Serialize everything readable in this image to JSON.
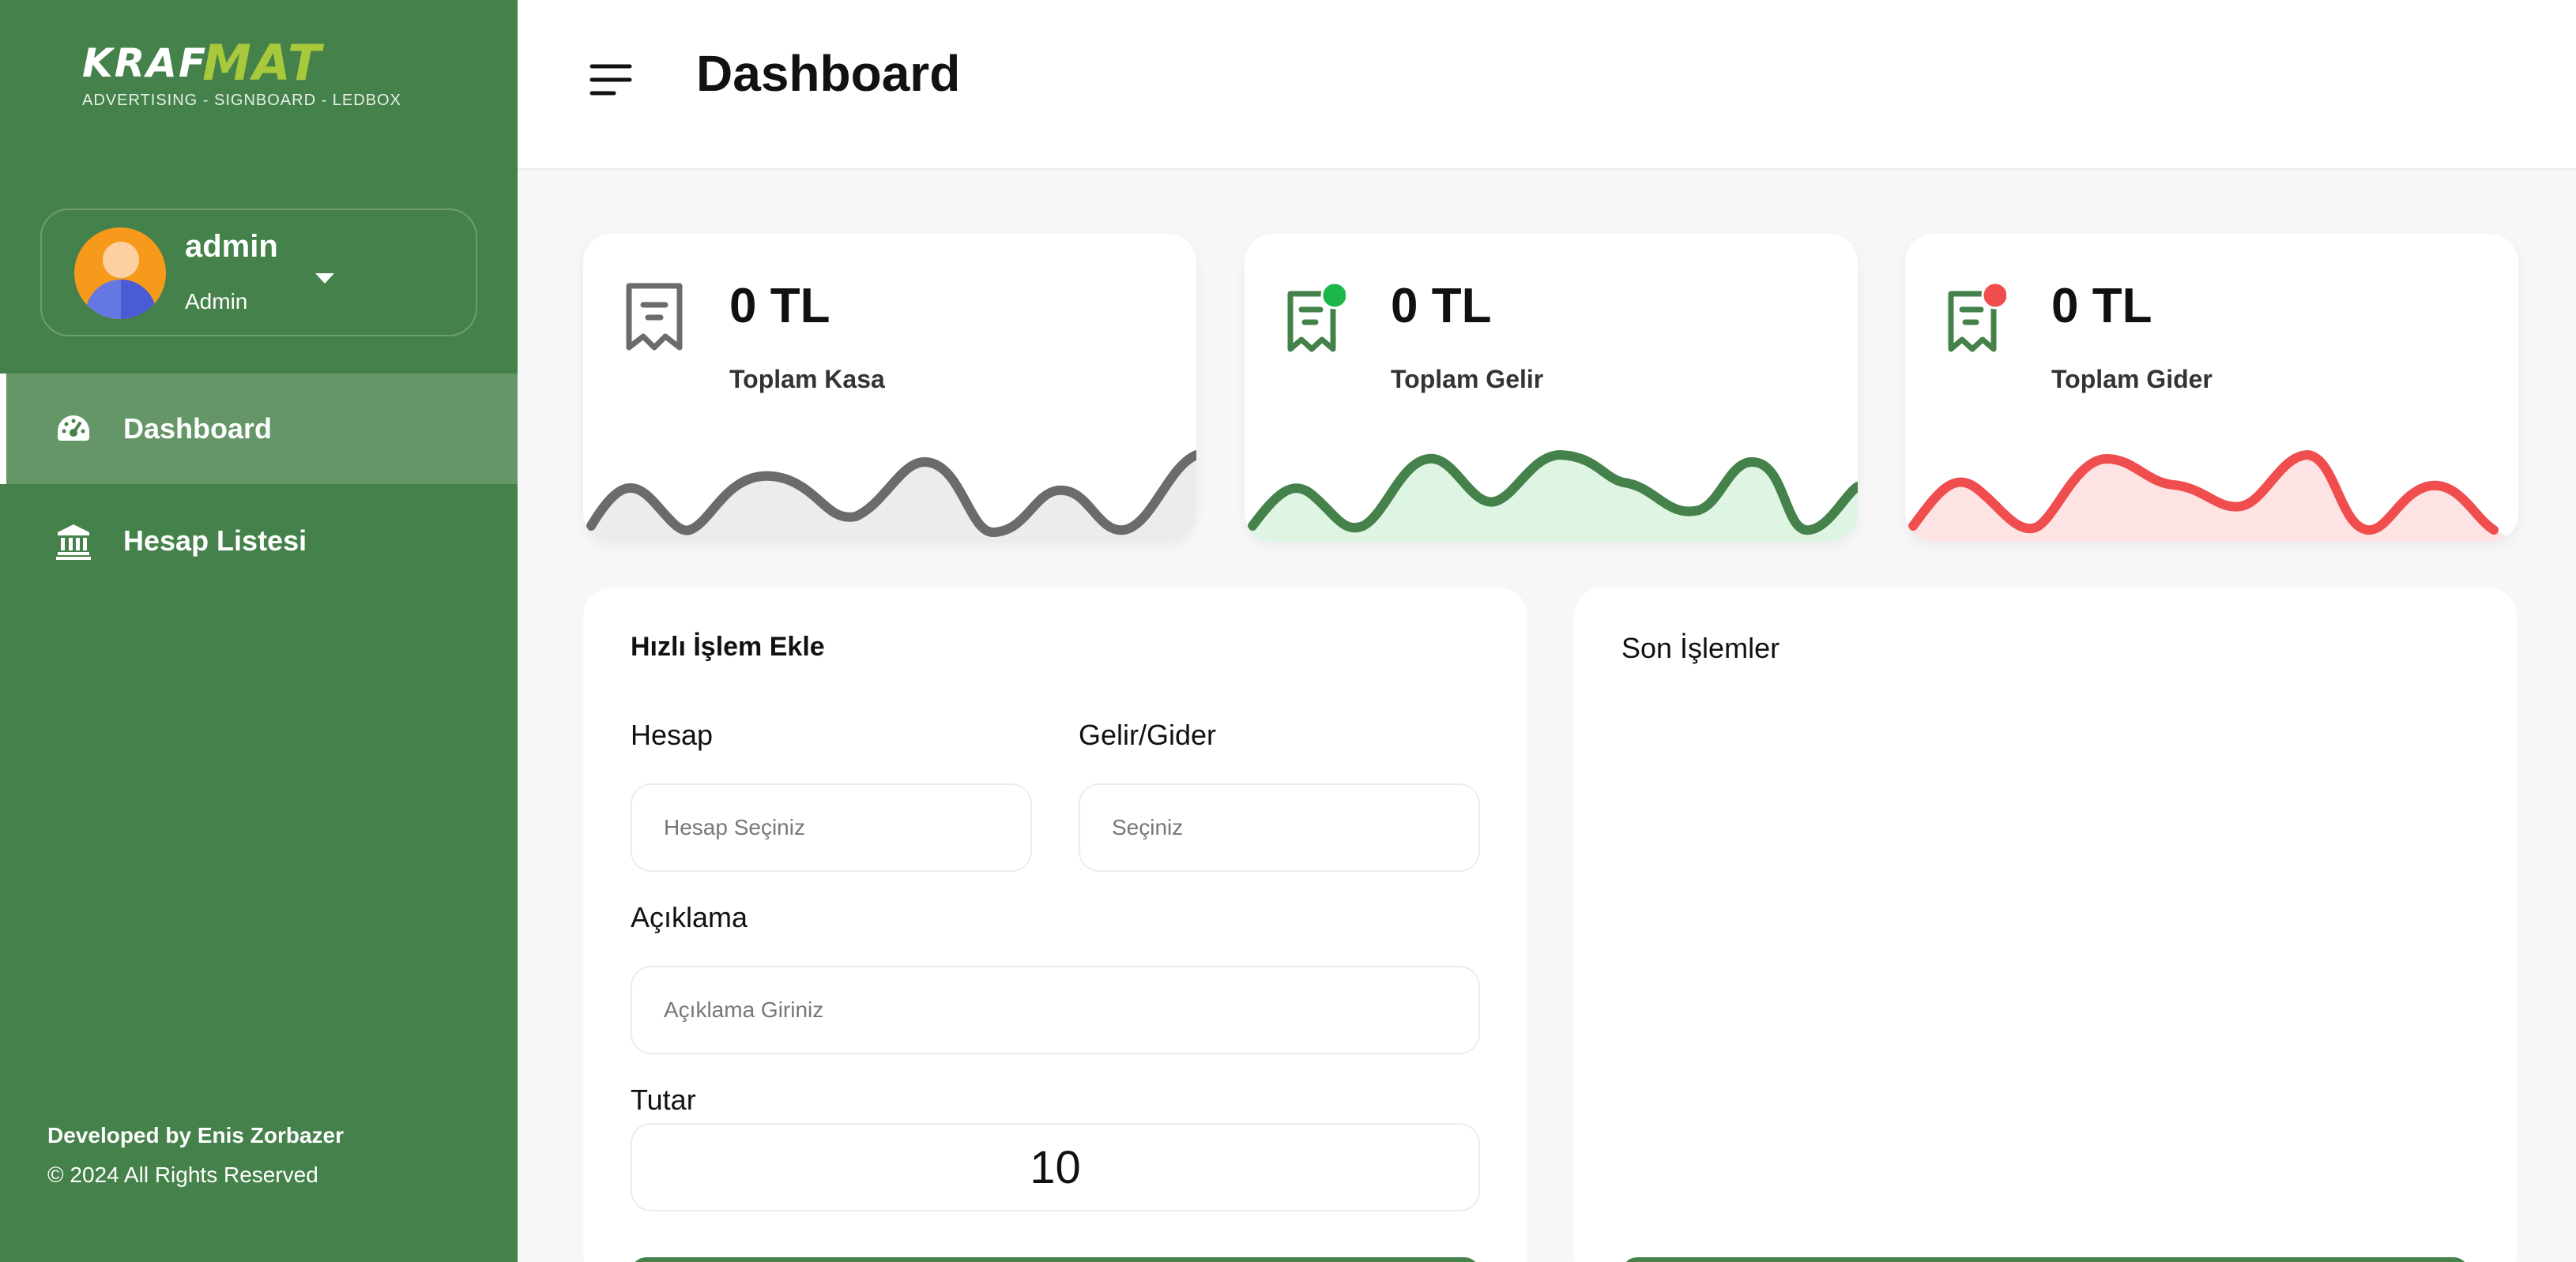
{
  "brand": {
    "logo_part1": "KRAF",
    "logo_part2": "MAT",
    "tagline": "ADVERTISING - SIGNBOARD - LEDBOX",
    "primary_color": "#45814a",
    "accent_color": "#a9c93c"
  },
  "user": {
    "name": "admin",
    "role": "Admin"
  },
  "sidebar": {
    "items": [
      {
        "label": "Dashboard",
        "icon": "gauge-icon",
        "active": true
      },
      {
        "label": "Hesap Listesi",
        "icon": "bank-icon",
        "active": false
      }
    ],
    "footer_dev": "Developed by Enis Zorbazer",
    "footer_copy": "© 2024 All Rights Reserved"
  },
  "header": {
    "title": "Dashboard"
  },
  "stats": [
    {
      "value": "0 TL",
      "label": "Toplam Kasa",
      "color": "#6b6b6b",
      "fill": "#ececec",
      "icon": "receipt-icon"
    },
    {
      "value": "0 TL",
      "label": "Toplam Gelir",
      "color": "#45814a",
      "fill": "#dff5e3",
      "dot_color": "#1db64a",
      "icon": "receipt-income-icon"
    },
    {
      "value": "0 TL",
      "label": "Toplam Gider",
      "color": "#f04e4e",
      "fill": "#fde3e3",
      "dot_color": "#f04e4e",
      "icon": "receipt-expense-icon"
    }
  ],
  "quick_form": {
    "title": "Hızlı İşlem Ekle",
    "account_label": "Hesap",
    "account_placeholder": "Hesap Seçiniz",
    "type_label": "Gelir/Gider",
    "type_placeholder": "Seçiniz",
    "description_label": "Açıklama",
    "description_placeholder": "Açıklama Giriniz",
    "amount_label": "Tutar",
    "amount_value": "10"
  },
  "recent": {
    "title": "Son İşlemler"
  }
}
